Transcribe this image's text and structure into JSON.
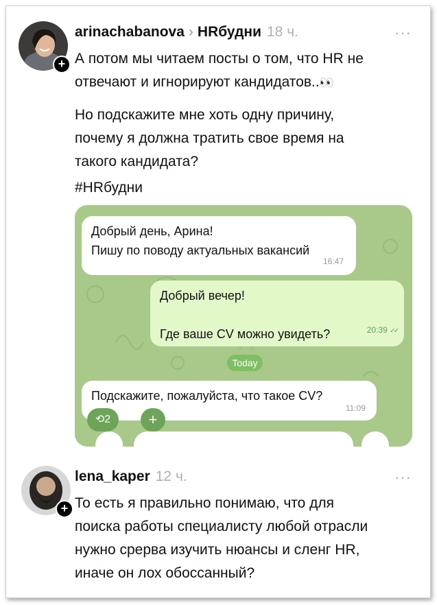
{
  "post1": {
    "username": "arinachabanova",
    "chevron": "›",
    "channel": "HRбудни",
    "time": "18 ч.",
    "more": "···",
    "line1": "А потом мы читаем посты о том, что HR не",
    "line2": "отвечают и игнорируют кандидатов..",
    "eyes_emoji": "👀",
    "para2_line1": "Но подскажите мне хоть одну причину,",
    "para2_line2": "почему я должна тратить свое время на",
    "para2_line3": "такого кандидата?",
    "hashtag": "#HRбудни"
  },
  "chat": {
    "msg1_line1": "Добрый день, Арина!",
    "msg1_line2": "Пишу по поводу актуальных вакансий",
    "msg1_time": "16:47",
    "msg2_line1": "Добрый вечер!",
    "msg2_line2": "Где ваше CV можно увидеть?",
    "msg2_time": "20:39",
    "msg2_ticks": "✓✓",
    "date_pill": "Today",
    "msg3_text": "Подскажите, пожалуйста, что такое CV?",
    "msg3_time": "11:09",
    "reaction_count": "2",
    "reaction_plus": "+"
  },
  "post2": {
    "username": "lena_kaper",
    "time": "12 ч.",
    "more": "···",
    "line1": "То есть я правильно понимаю, что для",
    "line2": "поиска работы специалисту любой отрасли",
    "line3": "нужно срерва изучить нюансы и сленг HR,",
    "line4": "иначе он лох обоссанный?"
  },
  "colors": {
    "chat_bg": "#a9c98b",
    "outgoing_bubble": "#e3f8c9",
    "incoming_bubble": "#ffffff",
    "date_pill": "#7fbf63"
  }
}
